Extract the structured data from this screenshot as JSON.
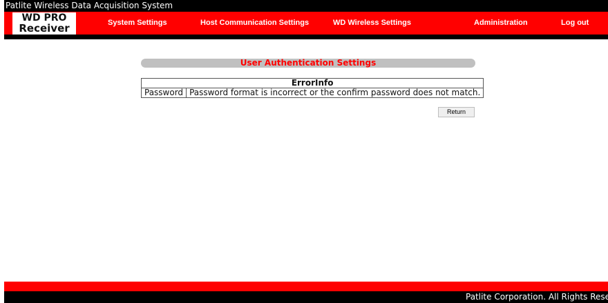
{
  "window": {
    "title": "Patlite Wireless Data Acquisition System"
  },
  "logo": {
    "line1": "WD PRO",
    "line2": "Receiver"
  },
  "nav": {
    "system_settings": "System Settings",
    "host_communication_settings": "Host Communication Settings",
    "wd_wireless_settings": "WD Wireless Settings",
    "administration": "Administration",
    "logout": "Log out"
  },
  "section": {
    "title": "User Authentication Settings"
  },
  "error_table": {
    "header": "ErrorInfo",
    "rows": [
      {
        "field": "Password",
        "message": "Password format is incorrect or the confirm password does not match."
      }
    ]
  },
  "actions": {
    "return_label": "Return"
  },
  "footer": {
    "copyright": "Patlite Corporation. All Rights Reserved"
  },
  "colors": {
    "brand_red": "#ff0000",
    "bar_black": "#000000",
    "header_gray": "#c0c0c0"
  }
}
